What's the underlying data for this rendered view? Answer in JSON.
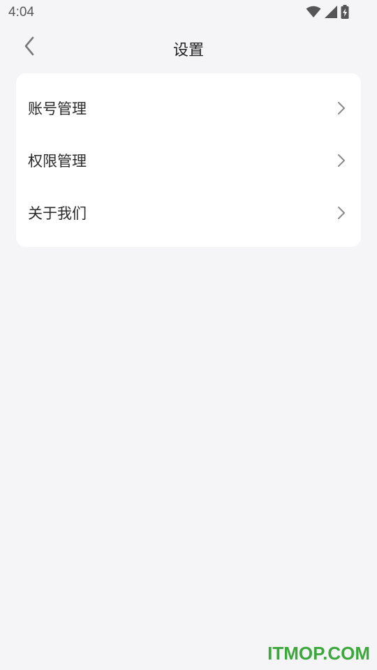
{
  "status_bar": {
    "time": "4:04",
    "icons": [
      "wifi-icon",
      "cellular-signal-icon",
      "battery-charging-icon"
    ]
  },
  "header": {
    "back_icon": "chevron-left-icon",
    "title": "设置"
  },
  "settings": {
    "items": [
      {
        "label": "账号管理",
        "icon": "chevron-right-icon"
      },
      {
        "label": "权限管理",
        "icon": "chevron-right-icon"
      },
      {
        "label": "关于我们",
        "icon": "chevron-right-icon"
      }
    ]
  },
  "watermark": {
    "text": "ITMOP.COM",
    "color": "#3ca83c"
  },
  "colors": {
    "background": "#f5f4f7",
    "card": "#ffffff",
    "text": "#2a2a2a",
    "chevron": "#8a8a8a"
  }
}
